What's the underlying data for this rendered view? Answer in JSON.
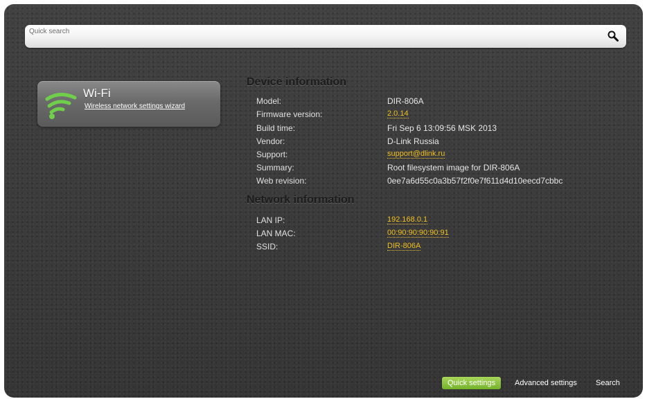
{
  "search": {
    "placeholder": "Quick search",
    "value": ""
  },
  "wifi_card": {
    "title": "Wi-Fi",
    "link_label": "Wireless network settings wizard"
  },
  "device_info": {
    "title": "Device information",
    "rows": [
      {
        "label": "Model:",
        "value": "DIR-806A",
        "is_link": false
      },
      {
        "label": "Firmware version:",
        "value": "2.0.14",
        "is_link": true
      },
      {
        "label": "Build time:",
        "value": "Fri Sep 6 13:09:56 MSK 2013",
        "is_link": false
      },
      {
        "label": "Vendor:",
        "value": "D-Link Russia",
        "is_link": false
      },
      {
        "label": "Support:",
        "value": "support@dlink.ru",
        "is_link": true
      },
      {
        "label": "Summary:",
        "value": "Root filesystem image for DIR-806A",
        "is_link": false
      },
      {
        "label": "Web revision:",
        "value": "0ee7a6d55c0a3b57f2f0e7f611d4d10eecd7cbbc",
        "is_link": false
      }
    ]
  },
  "network_info": {
    "title": "Network information",
    "rows": [
      {
        "label": "LAN IP:",
        "value": "192.168.0.1",
        "is_link": true
      },
      {
        "label": "LAN MAC:",
        "value": "00:90:90:90:90:91",
        "is_link": true
      },
      {
        "label": "SSID:",
        "value": "DIR-806A",
        "is_link": true
      }
    ]
  },
  "bottom_nav": {
    "quick_settings": "Quick settings",
    "advanced_settings": "Advanced settings",
    "search": "Search"
  },
  "colors": {
    "accent_green": "#8cc63f",
    "link_yellow": "#f0c020",
    "background": "#3a3a3a"
  },
  "icons": {
    "search": "search-icon",
    "wifi": "wifi-icon"
  }
}
